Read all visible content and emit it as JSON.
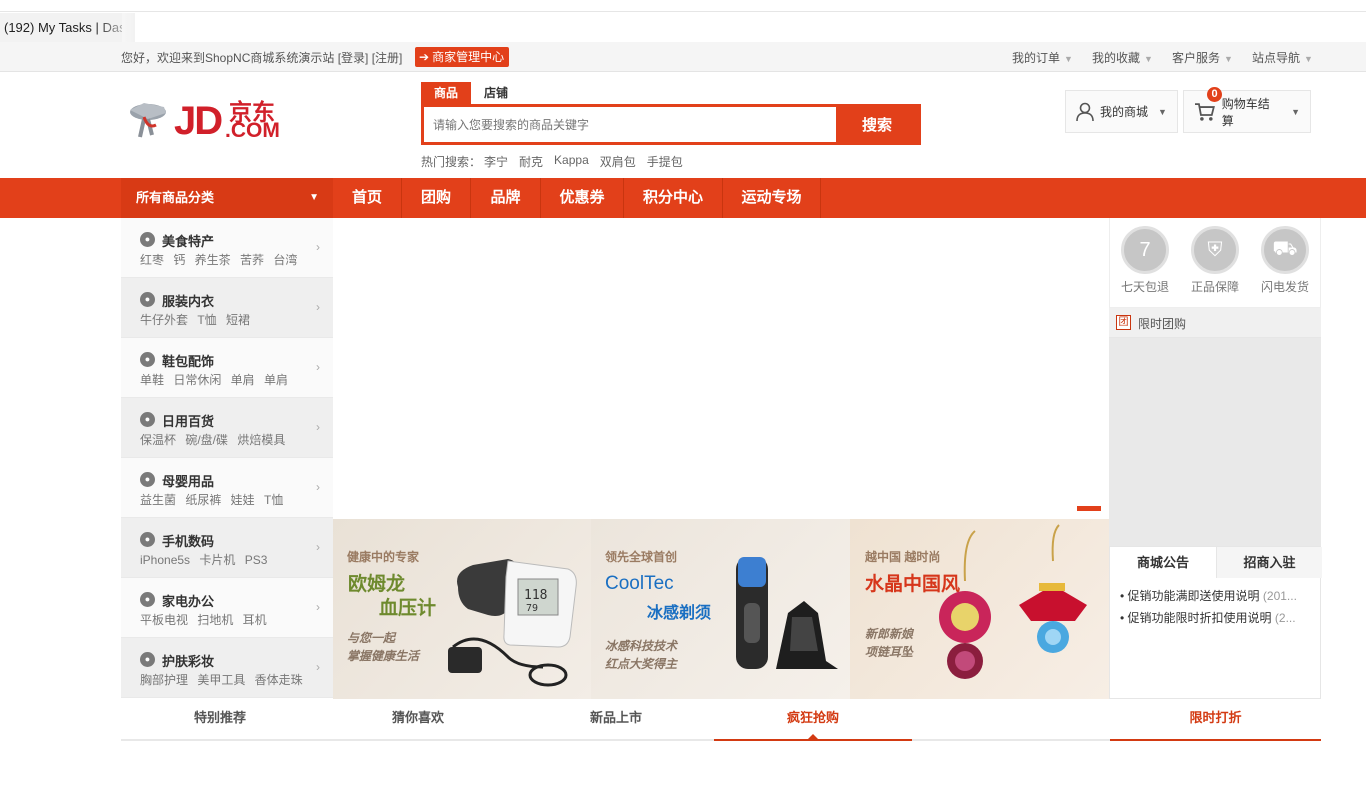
{
  "browser": {
    "tab_title": "(192) My Tasks | Das"
  },
  "topbar": {
    "welcome": "您好，欢迎来到ShopNC商城系统演示站 [登录] [注册]",
    "merchant_center": "商家管理中心",
    "links": [
      "我的订单",
      "我的收藏",
      "客户服务",
      "站点导航"
    ]
  },
  "logo": {
    "text_left": "JD",
    "text_right": ".COM",
    "chinese": "京东"
  },
  "search": {
    "tabs": [
      "商品",
      "店铺"
    ],
    "placeholder": "请输入您要搜索的商品关键字",
    "button": "搜索",
    "hot_label": "热门搜索：",
    "hot_keywords": [
      "李宁",
      "耐克",
      "Kappa",
      "双肩包",
      "手提包"
    ]
  },
  "header_actions": {
    "my_mall": "我的商城",
    "cart": "购物车结算",
    "cart_count": "0"
  },
  "nav": {
    "all_categories": "所有商品分类",
    "items": [
      "首页",
      "团购",
      "品牌",
      "优惠券",
      "积分中心",
      "运动专场"
    ]
  },
  "categories": [
    {
      "title": "美食特产",
      "subs": "红枣 钙 养生茶 苦荞 台湾",
      "icon": "food-icon"
    },
    {
      "title": "服装内衣",
      "subs": "牛仔外套 T恤 短裙",
      "icon": "clothes-icon"
    },
    {
      "title": "鞋包配饰",
      "subs": "单鞋 日常休闲 单肩 单肩",
      "icon": "bag-icon"
    },
    {
      "title": "日用百货",
      "subs": "保温杯 碗/盘/碟 烘焙模具",
      "icon": "daily-icon"
    },
    {
      "title": "母婴用品",
      "subs": "益生菌 纸尿裤 娃娃 T恤",
      "icon": "baby-icon"
    },
    {
      "title": "手机数码",
      "subs": "iPhone5s 卡片机 PS3",
      "icon": "phone-icon"
    },
    {
      "title": "家电办公",
      "subs": "平板电视 扫地机 耳机",
      "icon": "appliance-icon"
    },
    {
      "title": "护肤彩妆",
      "subs": "胸部护理 美甲工具 香体走珠",
      "icon": "cosmetics-icon"
    }
  ],
  "promos": [
    {
      "small": "健康中的专家",
      "big1": "欧姆龙",
      "big2": "血压计",
      "line1": "与您一起",
      "line2": "掌握健康生活",
      "color": "#6e8a2e"
    },
    {
      "small": "领先全球首创",
      "big1": "CoolTec",
      "big2": "冰感剃须",
      "line1": "冰感科技技术",
      "line2": "红点大奖得主",
      "color": "#1a6fc2"
    },
    {
      "small": "越中国 越时尚",
      "big1": "水晶中国风",
      "big2": "",
      "line1": "新郎新娘",
      "line2": "项链耳坠",
      "color": "#d6361b"
    }
  ],
  "services": [
    "七天包退",
    "正品保障",
    "闪电发货"
  ],
  "group_buy": {
    "icon_char": "团",
    "label": "限时团购"
  },
  "notice": {
    "tabs": [
      "商城公告",
      "招商入驻"
    ],
    "items": [
      {
        "text": "促销功能满即送使用说明",
        "date": "(201..."
      },
      {
        "text": "促销功能限时折扣使用说明",
        "date": "(2..."
      }
    ]
  },
  "bottom_tabs": [
    "特别推荐",
    "猜你喜欢",
    "新品上市",
    "疯狂抢购",
    "限时打折"
  ],
  "colors": {
    "brand": "#e2401a",
    "nav_dark": "#d83a15"
  }
}
